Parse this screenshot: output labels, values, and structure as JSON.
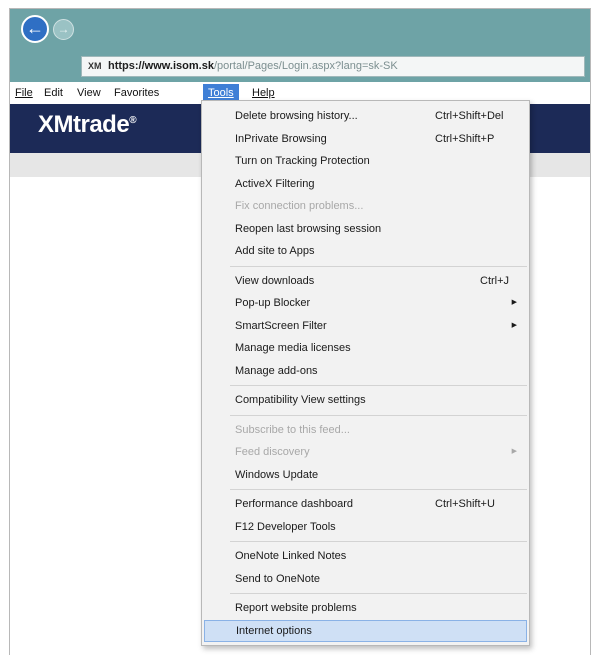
{
  "browser": {
    "url": {
      "scheme": "https://",
      "host": "www.isom.sk",
      "path": "/portal/Pages/Login.aspx?lang=sk-SK",
      "favicon_label": "XM"
    },
    "back_icon": "arrow-left-icon",
    "forward_icon": "arrow-right-icon"
  },
  "menubar": {
    "items": [
      {
        "label": "File"
      },
      {
        "label": "Edit"
      },
      {
        "label": "View"
      },
      {
        "label": "Favorites"
      },
      {
        "label": "Tools",
        "active": true
      },
      {
        "label": "Help"
      }
    ]
  },
  "site": {
    "logo_text": "XMtrade",
    "logo_mark": "®"
  },
  "tools_menu": {
    "groups": [
      [
        {
          "label": "Delete browsing history...",
          "shortcut": "Ctrl+Shift+Del"
        },
        {
          "label": "InPrivate Browsing",
          "shortcut": "Ctrl+Shift+P"
        },
        {
          "label": "Turn on Tracking Protection"
        },
        {
          "label": "ActiveX Filtering"
        },
        {
          "label": "Fix connection problems...",
          "disabled": true
        },
        {
          "label": "Reopen last browsing session"
        },
        {
          "label": "Add site to Apps"
        }
      ],
      [
        {
          "label": "View downloads",
          "shortcut": "Ctrl+J"
        },
        {
          "label": "Pop-up Blocker",
          "submenu": true
        },
        {
          "label": "SmartScreen Filter",
          "submenu": true
        },
        {
          "label": "Manage media licenses"
        },
        {
          "label": "Manage add-ons"
        }
      ],
      [
        {
          "label": "Compatibility View settings"
        }
      ],
      [
        {
          "label": "Subscribe to this feed...",
          "disabled": true
        },
        {
          "label": "Feed discovery",
          "disabled": true,
          "submenu": true
        },
        {
          "label": "Windows Update"
        }
      ],
      [
        {
          "label": "Performance dashboard",
          "shortcut": "Ctrl+Shift+U"
        },
        {
          "label": "F12 Developer Tools"
        }
      ],
      [
        {
          "label": "OneNote Linked Notes"
        },
        {
          "label": "Send to OneNote"
        }
      ],
      [
        {
          "label": "Report website problems"
        },
        {
          "label": "Internet options",
          "selected": true
        }
      ]
    ]
  },
  "colors": {
    "titlebar": "#6ea3a6",
    "banner": "#1c2a57",
    "menu_active": "#3f7fd6",
    "menu_selected": "#cfe0f5"
  }
}
